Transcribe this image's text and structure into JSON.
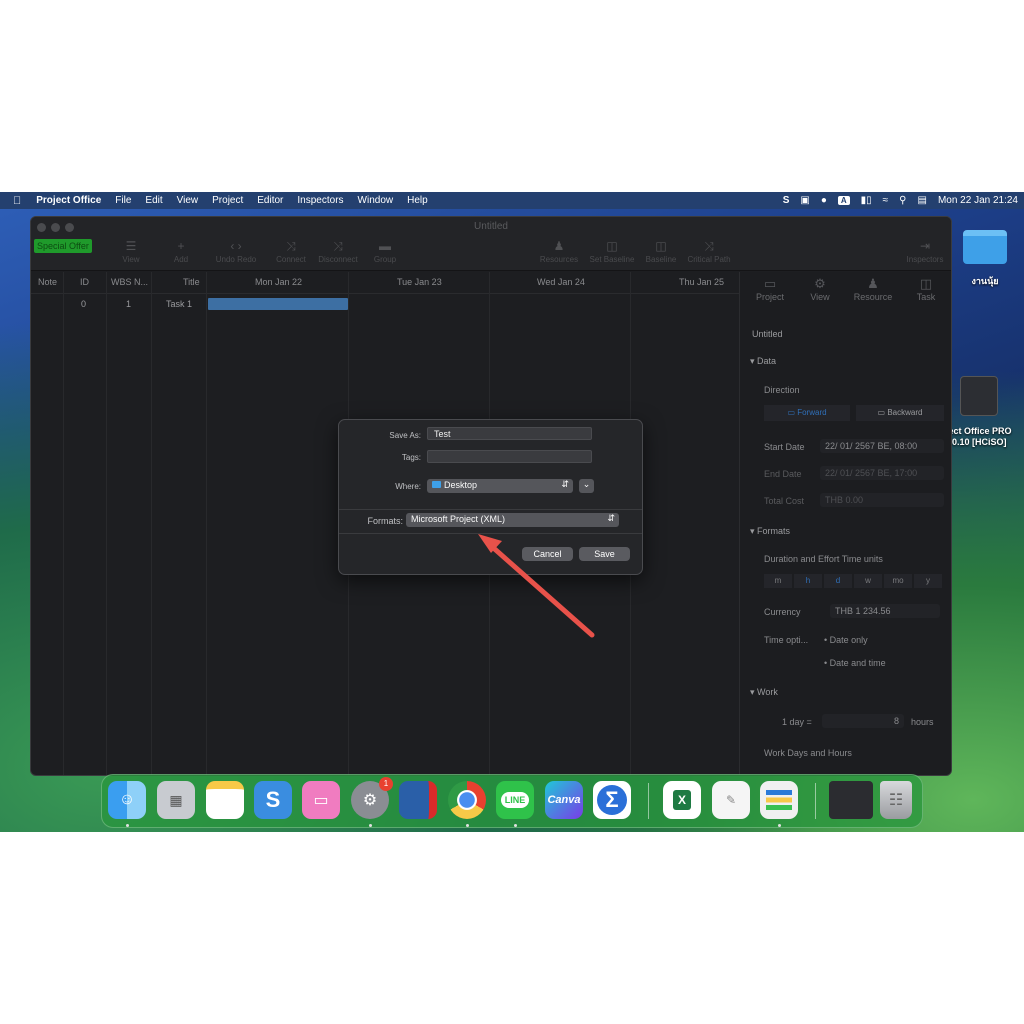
{
  "menubar": {
    "app_name": "Project Office",
    "items": [
      "File",
      "Edit",
      "View",
      "Project",
      "Editor",
      "Inspectors",
      "Window",
      "Help"
    ],
    "clock": "Mon 22 Jan  21:24",
    "input_source": "A"
  },
  "window": {
    "title": "Untitled",
    "special_offer": "Special Offer",
    "toolbar": {
      "view": "View",
      "add": "Add",
      "undo_redo": "Undo Redo",
      "connect": "Connect",
      "disconnect": "Disconnect",
      "group": "Group",
      "resources": "Resources",
      "set_baseline": "Set Baseline",
      "baseline": "Baseline",
      "critical_path": "Critical Path",
      "inspectors": "Inspectors"
    },
    "columns": {
      "note": "Note",
      "id": "ID",
      "wbs": "WBS N...",
      "title": "Title"
    },
    "dates": [
      "Mon Jan 22",
      "Tue Jan 23",
      "Wed Jan 24",
      "Thu Jan 25"
    ],
    "row": {
      "id": "0",
      "wbs": "1",
      "title": "Task 1"
    }
  },
  "inspector": {
    "tabs": [
      "Project",
      "View",
      "Resource",
      "Task"
    ],
    "project_name": "Untitled",
    "data_section": "Data",
    "direction_label": "Direction",
    "forward": "Forward",
    "backward": "Backward",
    "start_date_label": "Start Date",
    "start_date": "22/ 01/ 2567 BE, 08:00",
    "end_date_label": "End Date",
    "end_date": "22/ 01/ 2567 BE, 17:00",
    "total_cost_label": "Total Cost",
    "total_cost": "THB 0.00",
    "formats_section": "Formats",
    "time_units_label": "Duration and Effort Time units",
    "time_units": [
      "m",
      "h",
      "d",
      "w",
      "mo",
      "y"
    ],
    "currency_label": "Currency",
    "currency": "THB 1 234.56",
    "time_options_label": "Time opti...",
    "date_only": "Date only",
    "date_and_time": "Date and time",
    "work_section": "Work",
    "one_day": "1 day =",
    "hours_value": "8",
    "hours_label": "hours",
    "work_days_label": "Work Days and Hours"
  },
  "dialog": {
    "save_as_label": "Save As:",
    "save_as_value": "Test",
    "tags_label": "Tags:",
    "where_label": "Where:",
    "where_value": "Desktop",
    "formats_label": "Formats:",
    "formats_value": "Microsoft Project (XML)",
    "cancel": "Cancel",
    "save": "Save"
  },
  "desktop": {
    "folder_label": "งานนุ้ย",
    "app_label_1": "ject Office PRO",
    "app_label_2": "0.10 [HCiSO]"
  },
  "dock": {
    "badge": "1",
    "apps": [
      "finder-icon",
      "launchpad-icon",
      "notes-icon",
      "snagit-icon",
      "cleanmymac-icon",
      "system-settings-icon",
      "remote-desktop-icon",
      "chrome-icon",
      "line-icon",
      "canva-icon",
      "sigma-icon",
      "excel-icon",
      "textedit-icon",
      "project-office-icon",
      "screenshot-icon",
      "trash-icon"
    ],
    "line_label": "LINE",
    "canva_label": "Canva"
  },
  "colors": {
    "accent": "#3d6fa3",
    "arrow": "#e8524a",
    "dock": "#2a9a3c",
    "special_offer": "#1f9a2b"
  }
}
